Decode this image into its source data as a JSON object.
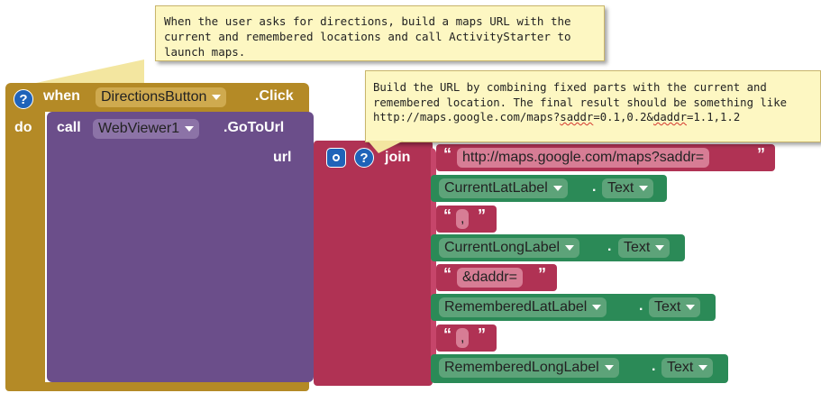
{
  "comments": {
    "top": "When the user asks for directions, build a maps URL with the current and remembered locations and call ActivityStarter to launch maps.",
    "join_line1": "Build the URL by combining fixed parts with the current and",
    "join_line2": "remembered location. The final result should be something like",
    "join_line3_a": "http://maps.google.com/maps?",
    "join_line3_saddr": "saddr",
    "join_line3_b": "=0.1,0.2&",
    "join_line3_daddr": "daddr",
    "join_line3_c": "=1.1,1.2"
  },
  "event": {
    "when": "when",
    "component": "DirectionsButton",
    "event_name": ".Click",
    "do": "do"
  },
  "call": {
    "call": "call",
    "component": "WebViewer1",
    "method": ".GoToUrl",
    "arg": "url"
  },
  "join": {
    "label": "join"
  },
  "string_quote_open": "“",
  "string_quote_close": "”",
  "strings": [
    "http://maps.google.com/maps?saddr=",
    ",",
    "&daddr=",
    ","
  ],
  "getters": [
    {
      "component": "CurrentLatLabel",
      "property": "Text"
    },
    {
      "component": "CurrentLongLabel",
      "property": "Text"
    },
    {
      "component": "RememberedLatLabel",
      "property": "Text"
    },
    {
      "component": "RememberedLongLabel",
      "property": "Text"
    }
  ],
  "dot": ".",
  "icons": {
    "help": "help-icon",
    "gear": "mutator-gear-icon"
  },
  "colors": {
    "event": "#b48a26",
    "call": "#6b4e8a",
    "text": "#b03254",
    "getter": "#2b8a57",
    "icon": "#1f63b9"
  }
}
